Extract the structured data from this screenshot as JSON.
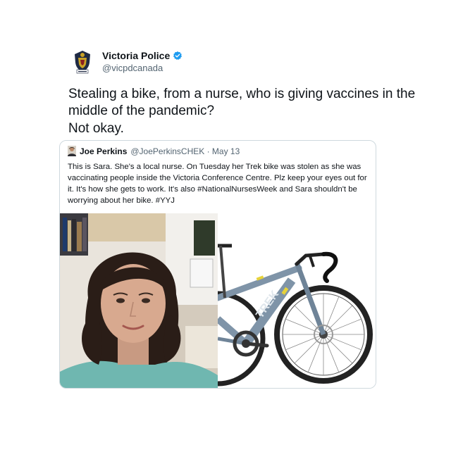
{
  "tweet": {
    "author_name": "Victoria Police",
    "author_handle": "@vicpdcanada",
    "text_line1": "Stealing a bike, from a nurse, who is giving vaccines in the middle of the pandemic?",
    "text_line2": "Not okay.",
    "avatar_icon": "police-crest-icon",
    "verified_icon": "verified-badge-icon",
    "verified_color": "#1d9bf0"
  },
  "quote": {
    "author_name": "Joe Perkins",
    "meta": "@JoePerkinsCHEK · May 13",
    "text": "This is Sara. She's a local nurse. On Tuesday her Trek bike was stolen as she was vaccinating people inside the Victoria Conference Centre. Plz keep your eyes out for it. It's how she gets to work. It's also #NationalNursesWeek and Sara shouldn't be worrying about her bike. #YYJ",
    "media": [
      {
        "name": "nurse-portrait-photo"
      },
      {
        "name": "bicycle-photo",
        "frame_lettering": "TREK"
      }
    ]
  }
}
